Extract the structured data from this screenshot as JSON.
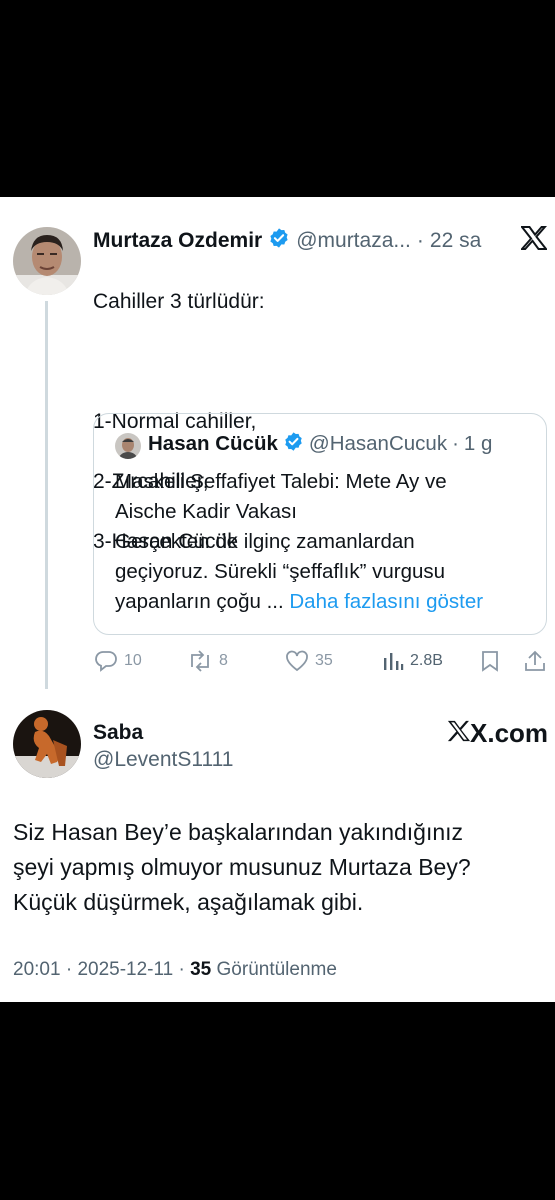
{
  "tweet": {
    "author_name": "Murtaza Ozdemir",
    "author_handle": "@murtaza...",
    "time": "22 sa",
    "text_lines": [
      "Cahiller 3 türlüdür:",
      "",
      "1-Normal cahiller,",
      "2-Zırcahiller,",
      "3-Hasan Cücük"
    ]
  },
  "quote": {
    "author_name": "Hasan Cücük",
    "author_handle": "@HasanCucuk",
    "time": "1 g",
    "line1": "Maskeli Şeffafiyet Talebi: Mete Ay ve",
    "line2": "Aische Kadir Vakası",
    "line3": "Gerçekten de ilginç zamanlardan",
    "line4": "geçiyoruz. Sürekli “şeffaflık” vurgusu",
    "line5": "yapanların çoğu ...",
    "show_more": "Daha fazlasını göster"
  },
  "actions": {
    "replies": "10",
    "retweets": "8",
    "likes": "35",
    "views": "2.8B"
  },
  "reply": {
    "name": "Saba",
    "handle": "@LeventS1111",
    "brand": "X.com",
    "line1": "Siz Hasan Bey’e başkalarından yakındığınız",
    "line2": "şeyi yapmış olmuyor musunuz Murtaza Bey?",
    "line3": "Küçük düşürmek, aşağılamak gibi.",
    "time": "20:01",
    "date": "2025-12-11",
    "views_count": "35",
    "views_label": "Görüntülenme"
  },
  "colors": {
    "verified": "#1d9bf0",
    "link": "#1d9bf0",
    "muted": "#536471"
  },
  "icons": [
    "verified-badge-icon",
    "x-logo-icon",
    "reply-icon",
    "retweet-icon",
    "like-icon",
    "views-icon",
    "bookmark-icon",
    "share-icon"
  ]
}
